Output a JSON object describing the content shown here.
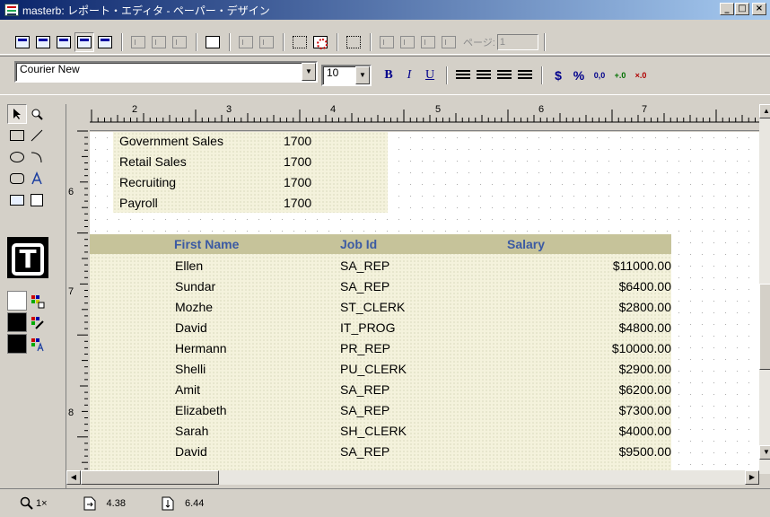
{
  "window": {
    "title": "masterb: レポート・エディタ - ペーパー・デザイン",
    "minimize": "_",
    "maximize": "□",
    "close": "×"
  },
  "toolbar_top": {
    "page_label": "ページ:",
    "page_value": "1"
  },
  "format_toolbar": {
    "font_name": "Courier New",
    "font_size": "10",
    "bold": "B",
    "italic": "I",
    "underline": "U",
    "currency": "$",
    "percent": "%",
    "comma": "0,0",
    "add_decimal": "+.0",
    "remove_decimal": "×.0"
  },
  "ruler": {
    "h_labels": [
      "2",
      "3",
      "4",
      "5",
      "6",
      "7"
    ],
    "v_labels": [
      "6",
      "7",
      "8"
    ]
  },
  "department_rows": [
    {
      "name": "Government Sales",
      "value": "1700"
    },
    {
      "name": "Retail Sales",
      "value": "1700"
    },
    {
      "name": "Recruiting",
      "value": "1700"
    },
    {
      "name": "Payroll",
      "value": "1700"
    }
  ],
  "employee_table": {
    "headers": {
      "first_name": "First Name",
      "job_id": "Job Id",
      "salary": "Salary"
    },
    "rows": [
      {
        "first_name": "Ellen",
        "job_id": "SA_REP",
        "salary": "$11000.00"
      },
      {
        "first_name": "Sundar",
        "job_id": "SA_REP",
        "salary": "$6400.00"
      },
      {
        "first_name": "Mozhe",
        "job_id": "ST_CLERK",
        "salary": "$2800.00"
      },
      {
        "first_name": "David",
        "job_id": "IT_PROG",
        "salary": "$4800.00"
      },
      {
        "first_name": "Hermann",
        "job_id": "PR_REP",
        "salary": "$10000.00"
      },
      {
        "first_name": "Shelli",
        "job_id": "PU_CLERK",
        "salary": "$2900.00"
      },
      {
        "first_name": "Amit",
        "job_id": "SA_REP",
        "salary": "$6200.00"
      },
      {
        "first_name": "Elizabeth",
        "job_id": "SA_REP",
        "salary": "$7300.00"
      },
      {
        "first_name": "Sarah",
        "job_id": "SH_CLERK",
        "salary": "$4000.00"
      },
      {
        "first_name": "David",
        "job_id": "SA_REP",
        "salary": "$9500.00"
      }
    ]
  },
  "status": {
    "zoom": "1×",
    "x_pos": "4.38",
    "y_pos": "6.44"
  }
}
